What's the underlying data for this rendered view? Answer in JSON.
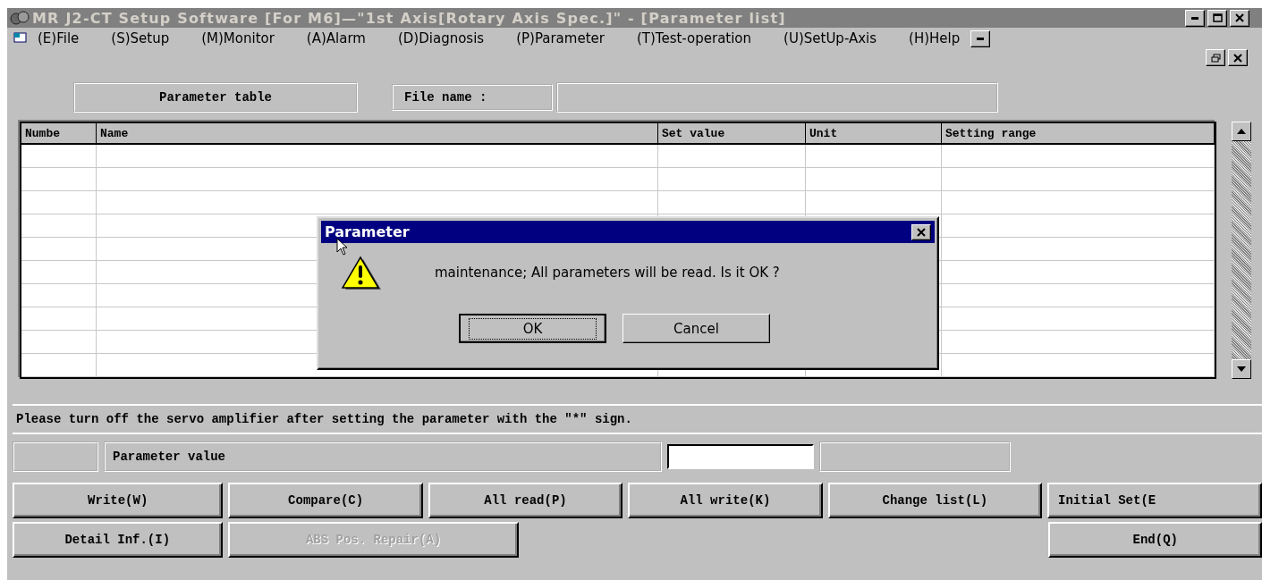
{
  "window": {
    "title": "MR J2-CT Setup Software [For M6]—\"1st Axis[Rotary Axis Spec.]\" - [Parameter list]",
    "active": false
  },
  "menu": [
    "(E)File",
    "(S)Setup",
    "(M)Monitor",
    "(A)Alarm",
    "(D)Diagnosis",
    "(P)Parameter",
    "(T)Test-operation",
    "(U)SetUp-Axis",
    "(H)Help"
  ],
  "header": {
    "table_label": "Parameter table",
    "file_label": "File name :"
  },
  "table": {
    "columns": [
      "Numbe",
      "Name",
      "Set value",
      "Unit",
      "Setting range"
    ]
  },
  "dialog": {
    "title": "Parameter",
    "message": "maintenance; All parameters will be read. Is it OK ?",
    "buttons": [
      {
        "label": "OK",
        "focused": true
      },
      {
        "label": "Cancel",
        "focused": false
      }
    ]
  },
  "notice": "Please turn off the servo amplifier after setting the parameter with the \"*\" sign.",
  "value_row": {
    "label": "Parameter value"
  },
  "buttons_row_1": [
    {
      "label": "Write(W)",
      "disabled": false
    },
    {
      "label": "Compare(C)",
      "disabled": false
    },
    {
      "label": "All read(P)",
      "disabled": false
    },
    {
      "label": "All write(K)",
      "disabled": false
    },
    {
      "label": "Change list(L)",
      "disabled": false
    },
    {
      "label": "Initial Set(E",
      "disabled": false
    }
  ],
  "buttons_row_2": [
    {
      "label": "Detail Inf.(I)",
      "disabled": false
    },
    {
      "label": "ABS Pos. Repair(A)",
      "disabled": true
    },
    {
      "label": "End(Q)",
      "disabled": false
    }
  ]
}
